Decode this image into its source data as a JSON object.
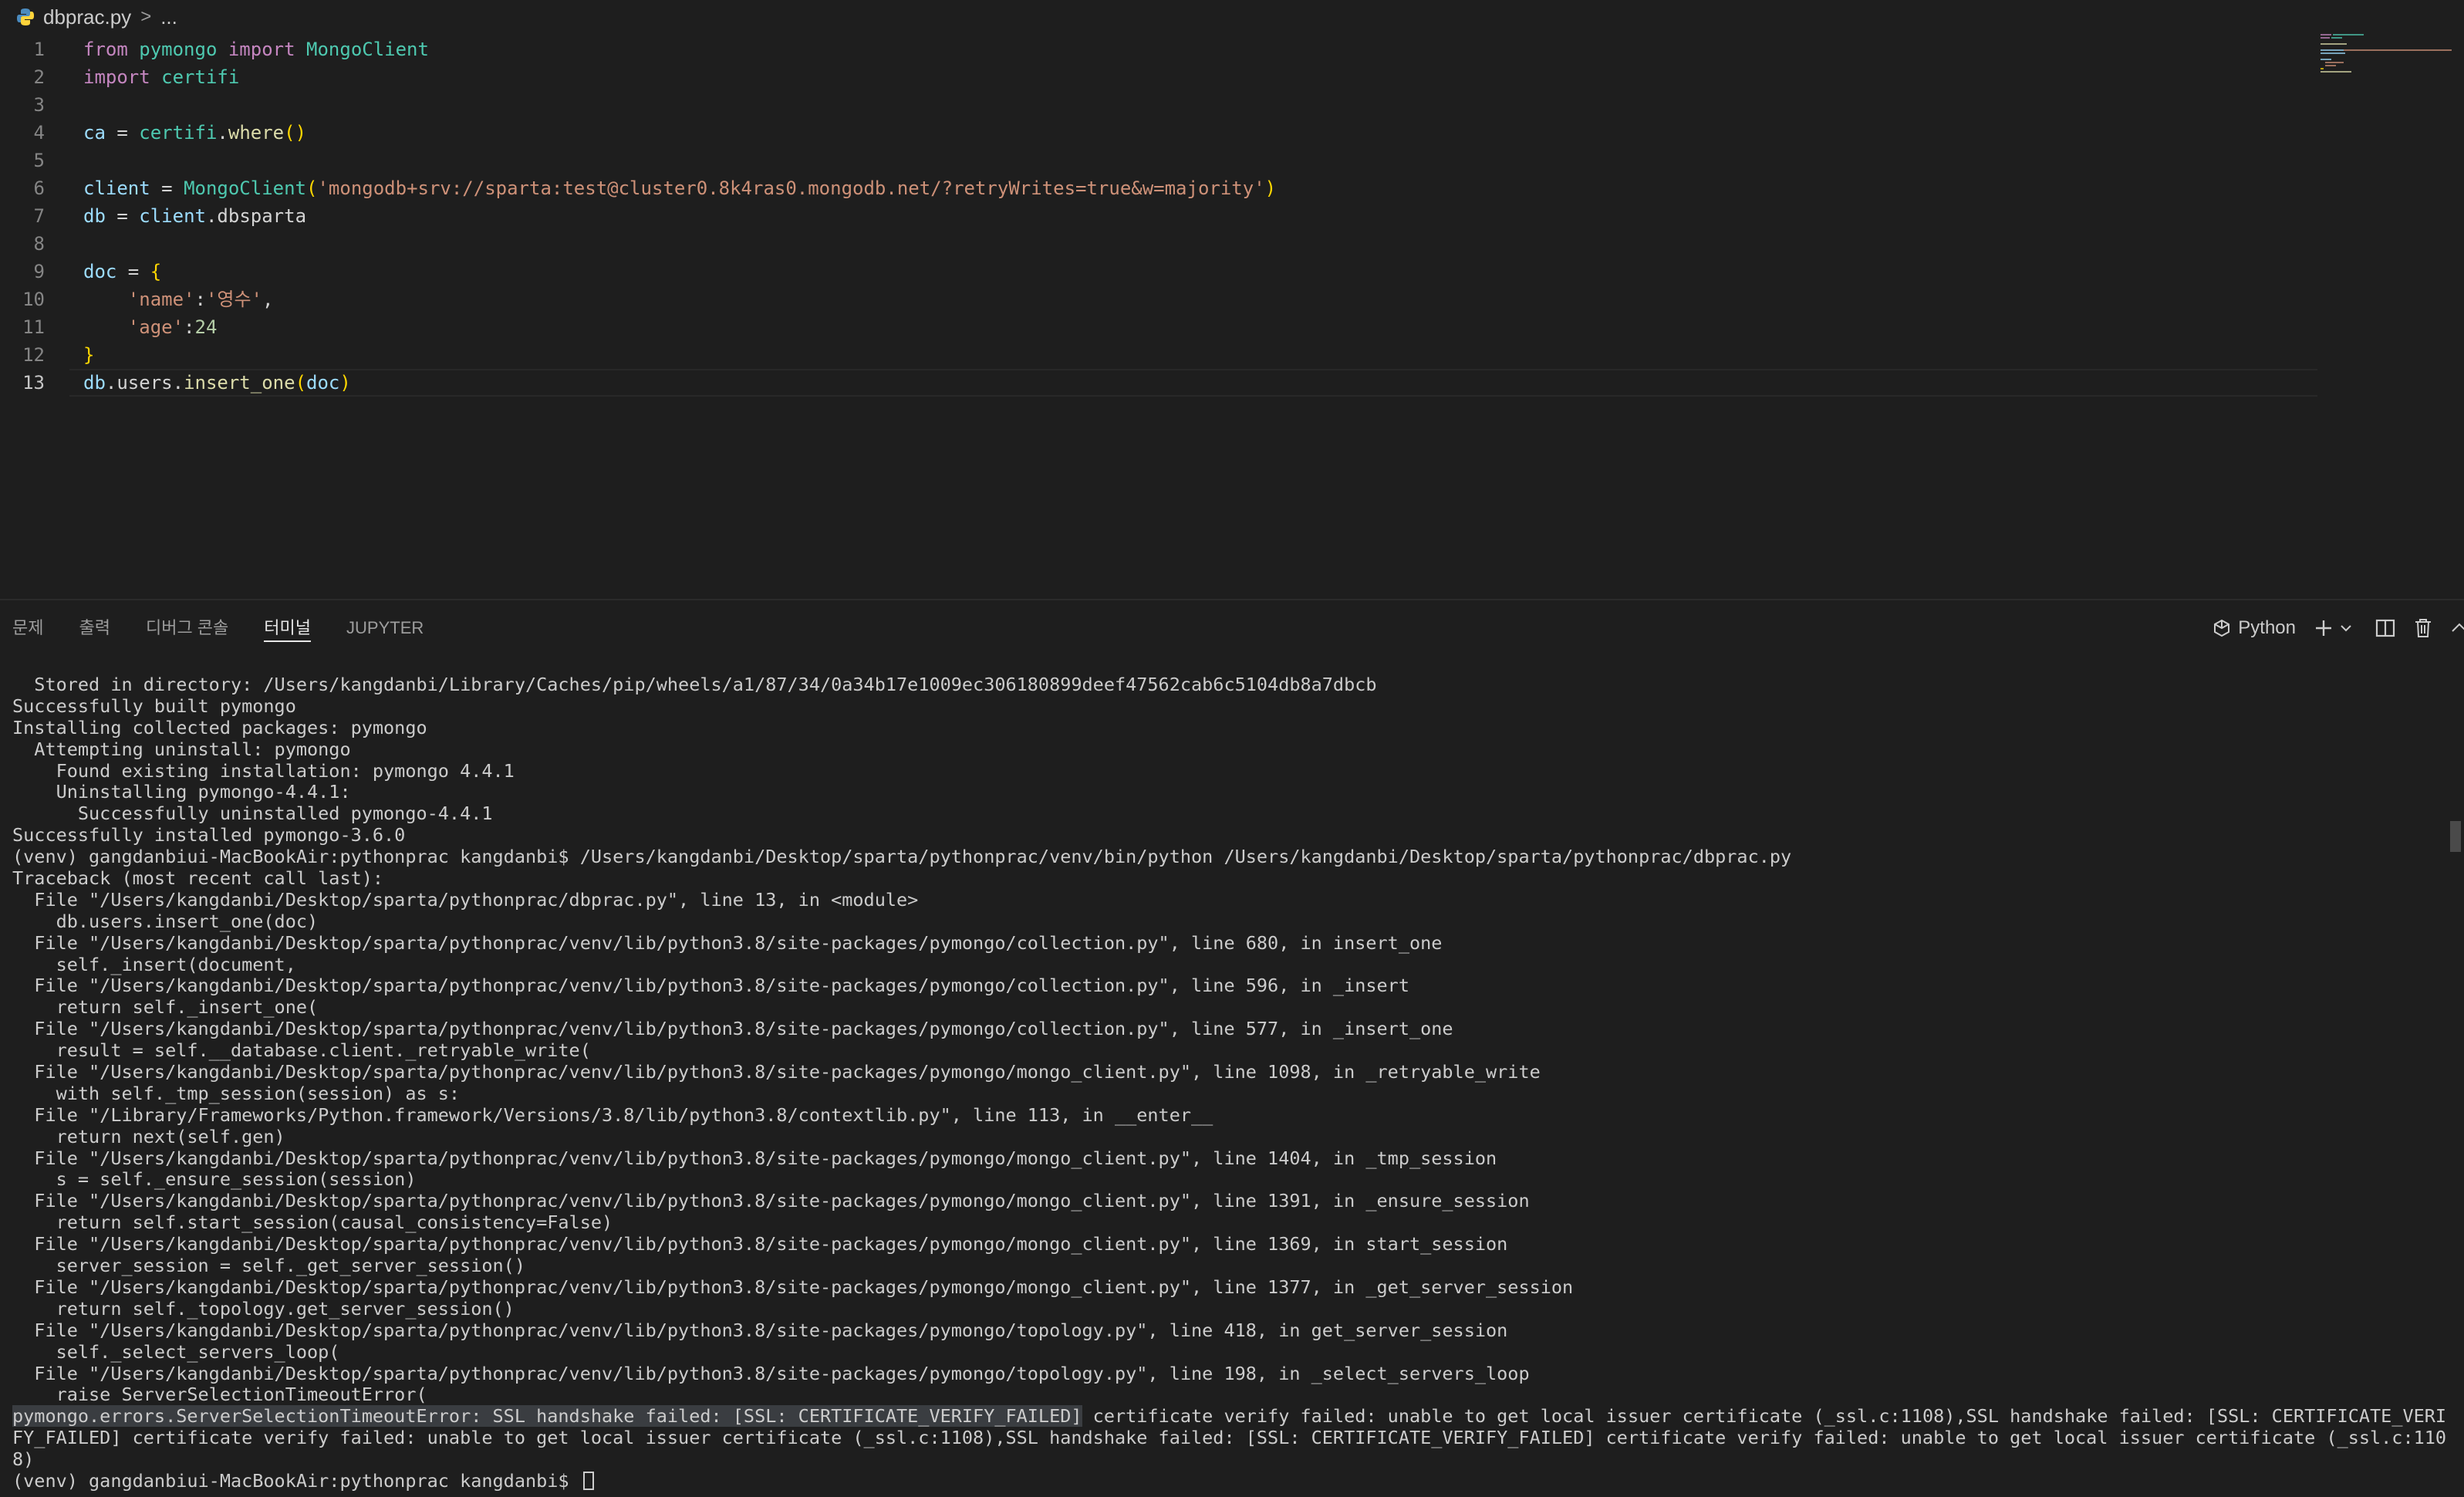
{
  "breadcrumb": {
    "file": "dbprac.py",
    "separator": ">",
    "more": "..."
  },
  "editor": {
    "active_line": 13,
    "lines": [
      {
        "n": "1",
        "tokens": [
          {
            "t": "from",
            "c": "kw"
          },
          {
            "t": " ",
            "c": ""
          },
          {
            "t": "pymongo",
            "c": "mod"
          },
          {
            "t": " ",
            "c": ""
          },
          {
            "t": "import",
            "c": "kw"
          },
          {
            "t": " ",
            "c": ""
          },
          {
            "t": "MongoClient",
            "c": "mod"
          }
        ]
      },
      {
        "n": "2",
        "tokens": [
          {
            "t": "import",
            "c": "kw"
          },
          {
            "t": " ",
            "c": ""
          },
          {
            "t": "certifi",
            "c": "mod"
          }
        ]
      },
      {
        "n": "3",
        "tokens": []
      },
      {
        "n": "4",
        "tokens": [
          {
            "t": "ca",
            "c": "var"
          },
          {
            "t": " = ",
            "c": ""
          },
          {
            "t": "certifi",
            "c": "mod"
          },
          {
            "t": ".",
            "c": ""
          },
          {
            "t": "where",
            "c": "fn"
          },
          {
            "t": "()",
            "c": "br"
          }
        ]
      },
      {
        "n": "5",
        "tokens": []
      },
      {
        "n": "6",
        "tokens": [
          {
            "t": "client",
            "c": "var"
          },
          {
            "t": " = ",
            "c": ""
          },
          {
            "t": "MongoClient",
            "c": "mod"
          },
          {
            "t": "(",
            "c": "br"
          },
          {
            "t": "'mongodb+srv://sparta:test@cluster0.8k4ras0.mongodb.net/?retryWrites=true&w=majority'",
            "c": "str"
          },
          {
            "t": ")",
            "c": "br"
          }
        ]
      },
      {
        "n": "7",
        "tokens": [
          {
            "t": "db",
            "c": "var"
          },
          {
            "t": " = ",
            "c": ""
          },
          {
            "t": "client",
            "c": "var"
          },
          {
            "t": ".dbsparta",
            "c": ""
          }
        ]
      },
      {
        "n": "8",
        "tokens": []
      },
      {
        "n": "9",
        "tokens": [
          {
            "t": "doc",
            "c": "var"
          },
          {
            "t": " = ",
            "c": ""
          },
          {
            "t": "{",
            "c": "br"
          }
        ]
      },
      {
        "n": "10",
        "tokens": [
          {
            "t": "    ",
            "c": ""
          },
          {
            "t": "'name'",
            "c": "str"
          },
          {
            "t": ":",
            "c": ""
          },
          {
            "t": "'영수'",
            "c": "str"
          },
          {
            "t": ",",
            "c": ""
          }
        ]
      },
      {
        "n": "11",
        "tokens": [
          {
            "t": "    ",
            "c": ""
          },
          {
            "t": "'age'",
            "c": "str"
          },
          {
            "t": ":",
            "c": ""
          },
          {
            "t": "24",
            "c": "num"
          }
        ]
      },
      {
        "n": "12",
        "tokens": [
          {
            "t": "}",
            "c": "br"
          }
        ]
      },
      {
        "n": "13",
        "tokens": [
          {
            "t": "db",
            "c": "var"
          },
          {
            "t": ".users.",
            "c": ""
          },
          {
            "t": "insert_one",
            "c": "fn"
          },
          {
            "t": "(",
            "c": "br"
          },
          {
            "t": "doc",
            "c": "var"
          },
          {
            "t": ")",
            "c": "br"
          }
        ]
      }
    ]
  },
  "panel": {
    "tabs": [
      {
        "label": "문제",
        "active": false
      },
      {
        "label": "출력",
        "active": false
      },
      {
        "label": "디버그 콘솔",
        "active": false
      },
      {
        "label": "터미널",
        "active": true
      },
      {
        "label": "JUPYTER",
        "active": false
      }
    ],
    "terminal_profile": "Python"
  },
  "terminal": {
    "lines": [
      "  Stored in directory: /Users/kangdanbi/Library/Caches/pip/wheels/a1/87/34/0a34b17e1009ec306180899deef47562cab6c5104db8a7dbcb",
      "Successfully built pymongo",
      "Installing collected packages: pymongo",
      "  Attempting uninstall: pymongo",
      "    Found existing installation: pymongo 4.4.1",
      "    Uninstalling pymongo-4.4.1:",
      "      Successfully uninstalled pymongo-4.4.1",
      "Successfully installed pymongo-3.6.0",
      "(venv) gangdanbiui-MacBookAir:pythonprac kangdanbi$ /Users/kangdanbi/Desktop/sparta/pythonprac/venv/bin/python /Users/kangdanbi/Desktop/sparta/pythonprac/dbprac.py",
      "Traceback (most recent call last):",
      "  File \"/Users/kangdanbi/Desktop/sparta/pythonprac/dbprac.py\", line 13, in <module>",
      "    db.users.insert_one(doc)",
      "  File \"/Users/kangdanbi/Desktop/sparta/pythonprac/venv/lib/python3.8/site-packages/pymongo/collection.py\", line 680, in insert_one",
      "    self._insert(document,",
      "  File \"/Users/kangdanbi/Desktop/sparta/pythonprac/venv/lib/python3.8/site-packages/pymongo/collection.py\", line 596, in _insert",
      "    return self._insert_one(",
      "  File \"/Users/kangdanbi/Desktop/sparta/pythonprac/venv/lib/python3.8/site-packages/pymongo/collection.py\", line 577, in _insert_one",
      "    result = self.__database.client._retryable_write(",
      "  File \"/Users/kangdanbi/Desktop/sparta/pythonprac/venv/lib/python3.8/site-packages/pymongo/mongo_client.py\", line 1098, in _retryable_write",
      "    with self._tmp_session(session) as s:",
      "  File \"/Library/Frameworks/Python.framework/Versions/3.8/lib/python3.8/contextlib.py\", line 113, in __enter__",
      "    return next(self.gen)",
      "  File \"/Users/kangdanbi/Desktop/sparta/pythonprac/venv/lib/python3.8/site-packages/pymongo/mongo_client.py\", line 1404, in _tmp_session",
      "    s = self._ensure_session(session)",
      "  File \"/Users/kangdanbi/Desktop/sparta/pythonprac/venv/lib/python3.8/site-packages/pymongo/mongo_client.py\", line 1391, in _ensure_session",
      "    return self.start_session(causal_consistency=False)",
      "  File \"/Users/kangdanbi/Desktop/sparta/pythonprac/venv/lib/python3.8/site-packages/pymongo/mongo_client.py\", line 1369, in start_session",
      "    server_session = self._get_server_session()",
      "  File \"/Users/kangdanbi/Desktop/sparta/pythonprac/venv/lib/python3.8/site-packages/pymongo/mongo_client.py\", line 1377, in _get_server_session",
      "    return self._topology.get_server_session()",
      "  File \"/Users/kangdanbi/Desktop/sparta/pythonprac/venv/lib/python3.8/site-packages/pymongo/topology.py\", line 418, in get_server_session",
      "    self._select_servers_loop(",
      "  File \"/Users/kangdanbi/Desktop/sparta/pythonprac/venv/lib/python3.8/site-packages/pymongo/topology.py\", line 198, in _select_servers_loop",
      "    raise ServerSelectionTimeoutError("
    ],
    "error_selected": "pymongo.errors.ServerSelectionTimeoutError: SSL handshake failed: [SSL: CERTIFICATE_VERIFY_FAILED]",
    "error_rest": " certificate verify failed: unable to get local issuer certificate (_ssl.c:1108),SSL handshake failed: [SSL: CERTIFICATE_VERI",
    "error_line2": "FY_FAILED] certificate verify failed: unable to get local issuer certificate (_ssl.c:1108),SSL handshake failed: [SSL: CERTIFICATE_VERIFY_FAILED] certificate verify failed: unable to get local issuer certificate (_ssl.c:110",
    "error_line3": "8)",
    "prompt": "(venv) gangdanbiui-MacBookAir:pythonprac kangdanbi$ "
  },
  "icons": {
    "file": "python-file-icon",
    "profile": "python-profile-icon",
    "add": "plus-icon",
    "dropdown": "chevron-down-icon",
    "split": "split-terminal-icon",
    "kill": "trash-icon",
    "maximize": "chevron-up-icon"
  },
  "colors": {
    "background": "#1e1e1e",
    "keyword": "#c586c0",
    "module": "#4ec9b0",
    "variable": "#9cdcfe",
    "function": "#dcdcaa",
    "string": "#ce9178",
    "number": "#b5cea8",
    "bracket": "#ffd700"
  }
}
